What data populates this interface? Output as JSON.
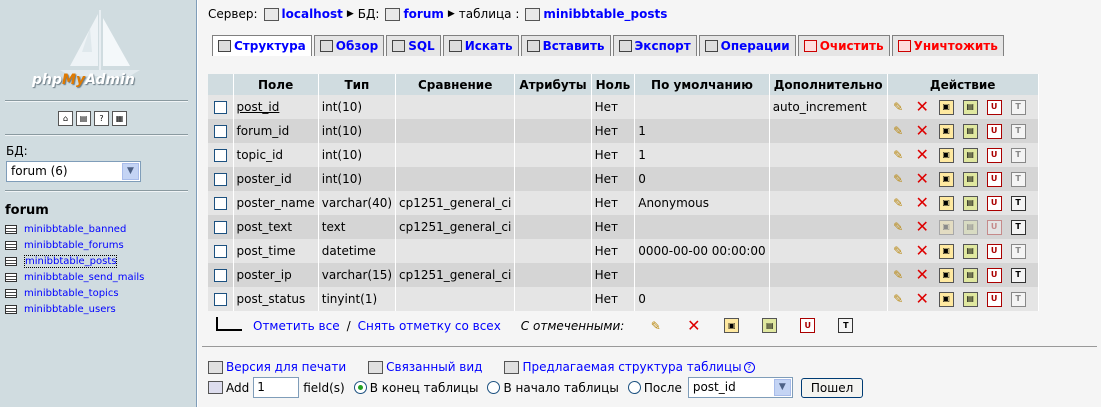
{
  "sidebar": {
    "logo_text_php": "php",
    "logo_text_my": "My",
    "logo_text_admin": "Admin",
    "db_label": "БД:",
    "db_select_value": "forum (6)",
    "db_title": "forum",
    "tables": [
      {
        "name": "minibbtable_banned"
      },
      {
        "name": "minibbtable_forums"
      },
      {
        "name": "minibbtable_posts"
      },
      {
        "name": "minibbtable_send_mails"
      },
      {
        "name": "minibbtable_topics"
      },
      {
        "name": "minibbtable_users"
      }
    ]
  },
  "breadcrumb": {
    "server_label": "Сервер:",
    "server": "localhost",
    "db_label": "БД:",
    "db": "forum",
    "table_label": "таблица :",
    "table": "minibbtable_posts"
  },
  "tabs": [
    {
      "label": "Структура",
      "icon": "structure-icon"
    },
    {
      "label": "Обзор",
      "icon": "browse-icon"
    },
    {
      "label": "SQL",
      "icon": "sql-icon"
    },
    {
      "label": "Искать",
      "icon": "search-icon"
    },
    {
      "label": "Вставить",
      "icon": "insert-icon"
    },
    {
      "label": "Экспорт",
      "icon": "export-icon"
    },
    {
      "label": "Операции",
      "icon": "operations-icon"
    },
    {
      "label": "Очистить",
      "icon": "empty-icon"
    },
    {
      "label": "Уничтожить",
      "icon": "drop-icon"
    }
  ],
  "table": {
    "headers": [
      "Поле",
      "Тип",
      "Сравнение",
      "Атрибуты",
      "Ноль",
      "По умолчанию",
      "Дополнительно",
      "Действие"
    ],
    "rows": [
      {
        "field": "post_id",
        "type": "int(10)",
        "collation": "",
        "attributes": "",
        "null": "Нет",
        "default": "",
        "extra": "auto_increment"
      },
      {
        "field": "forum_id",
        "type": "int(10)",
        "collation": "",
        "attributes": "",
        "null": "Нет",
        "default": "1",
        "extra": ""
      },
      {
        "field": "topic_id",
        "type": "int(10)",
        "collation": "",
        "attributes": "",
        "null": "Нет",
        "default": "1",
        "extra": ""
      },
      {
        "field": "poster_id",
        "type": "int(10)",
        "collation": "",
        "attributes": "",
        "null": "Нет",
        "default": "0",
        "extra": ""
      },
      {
        "field": "poster_name",
        "type": "varchar(40)",
        "collation": "cp1251_general_ci",
        "attributes": "",
        "null": "Нет",
        "default": "Anonymous",
        "extra": ""
      },
      {
        "field": "post_text",
        "type": "text",
        "collation": "cp1251_general_ci",
        "attributes": "",
        "null": "Нет",
        "default": "",
        "extra": ""
      },
      {
        "field": "post_time",
        "type": "datetime",
        "collation": "",
        "attributes": "",
        "null": "Нет",
        "default": "0000-00-00 00:00:00",
        "extra": ""
      },
      {
        "field": "poster_ip",
        "type": "varchar(15)",
        "collation": "cp1251_general_ci",
        "attributes": "",
        "null": "Нет",
        "default": "",
        "extra": ""
      },
      {
        "field": "post_status",
        "type": "tinyint(1)",
        "collation": "",
        "attributes": "",
        "null": "Нет",
        "default": "0",
        "extra": ""
      }
    ]
  },
  "bulk": {
    "check_all": "Отметить все",
    "slash": "/",
    "uncheck_all": "Снять отметку со всех",
    "with_selected": "С отмеченными:"
  },
  "links": {
    "print": "Версия для печати",
    "relation": "Связанный вид",
    "propose": "Предлагаемая структура таблицы"
  },
  "add_field": {
    "add_label": "Add",
    "count": "1",
    "fields_label": "field(s)",
    "at_end": "В конец таблицы",
    "at_start": "В начало таблицы",
    "after": "После",
    "after_value": "post_id",
    "go": "Пошел"
  }
}
